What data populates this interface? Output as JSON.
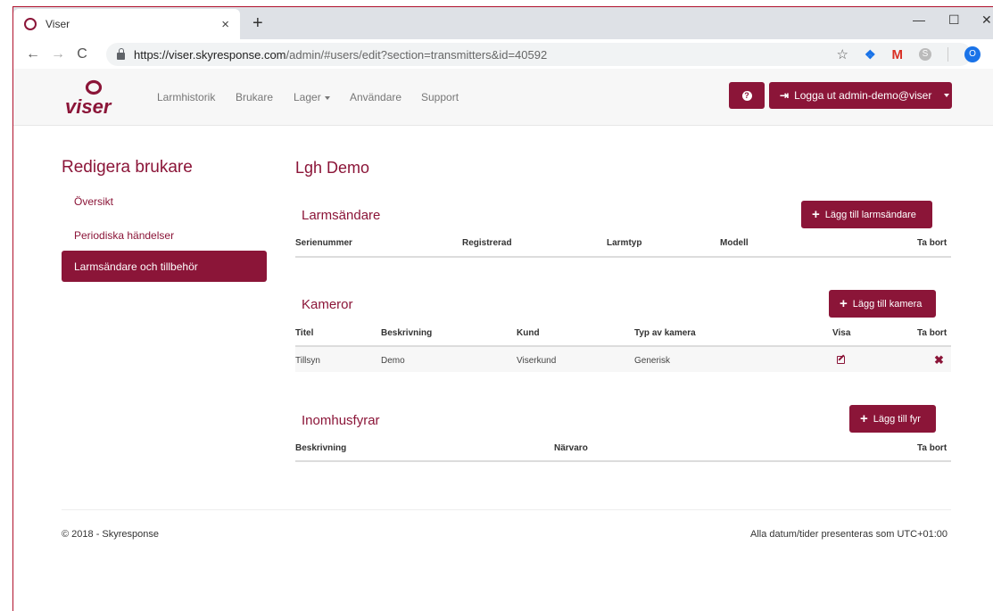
{
  "browser": {
    "tab_title": "Viser",
    "tab_close": "×",
    "new_tab": "+",
    "url_host": "https://viser.skyresponse.com",
    "url_path": "/admin/#users/edit?section=transmitters&id=40592",
    "profile_initial": "O",
    "ext_m": "M",
    "ext_s": "S"
  },
  "header": {
    "logo_text": "viser",
    "nav": [
      "Larmhistorik",
      "Brukare",
      "Lager",
      "Användare",
      "Support"
    ],
    "help_glyph": "?",
    "logout_label": "Logga ut admin-demo@viser"
  },
  "sidebar": {
    "heading": "Redigera brukare",
    "items": [
      "Översikt",
      "Periodiska händelser",
      "Larmsändare och tillbehör"
    ],
    "active_index": 2
  },
  "main": {
    "title": "Lgh Demo",
    "transmitters": {
      "title": "Larmsändare",
      "add_label": "Lägg till larmsändare",
      "columns": [
        "Serienummer",
        "Registrerad",
        "Larmtyp",
        "Modell",
        "Ta bort"
      ],
      "rows": []
    },
    "cameras": {
      "title": "Kameror",
      "add_label": "Lägg till kamera",
      "columns": [
        "Titel",
        "Beskrivning",
        "Kund",
        "Typ av kamera",
        "Visa",
        "Ta bort"
      ],
      "rows": [
        {
          "titel": "Tillsyn",
          "beskrivning": "Demo",
          "kund": "Viserkund",
          "typ": "Generisk"
        }
      ]
    },
    "beacons": {
      "title": "Inomhusfyrar",
      "add_label": "Lägg till fyr",
      "columns": [
        "Beskrivning",
        "Närvaro",
        "Ta bort"
      ],
      "rows": []
    }
  },
  "footer": {
    "copyright": "© 2018 - Skyresponse",
    "timezone_note": "Alla datum/tider presenteras som UTC+01:00"
  },
  "colors": {
    "brand": "#8b1538",
    "header_bg": "#f7f7f7"
  },
  "icons": [
    "viser-logo",
    "help-icon",
    "sign-out-icon",
    "plus-icon",
    "edit-icon",
    "delete-icon",
    "lock-icon",
    "star-icon"
  ]
}
